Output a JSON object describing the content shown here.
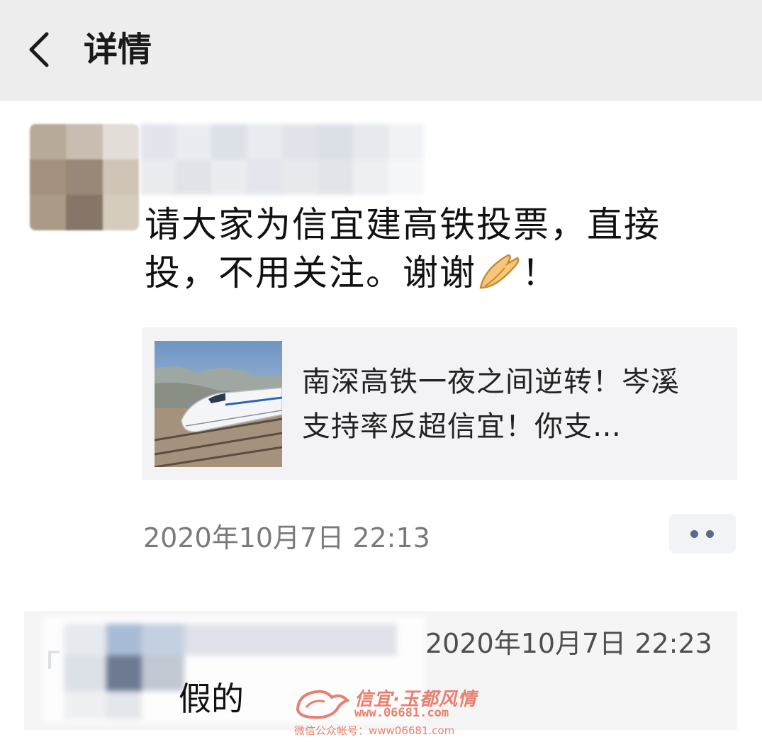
{
  "header": {
    "title": "详情"
  },
  "post": {
    "text_line1": "请大家为信宜建高铁投票，直接",
    "text_line2_a": "投，不用关注。谢谢",
    "text_line2_b": "！",
    "emoji_icon": "pray-hands-emoji",
    "timestamp": "2020年10月7日 22:13",
    "link": {
      "title": "南深高铁一夜之间逆转！岑溪支持率反超信宜！你支…",
      "thumbnail": "high-speed-train-photo"
    }
  },
  "comment": {
    "time": "2020年10月7日 22:23",
    "text": "假的"
  },
  "watermark": {
    "brand": "信宜·玉都风情",
    "url": "www.06681.com",
    "line": "微信公众帐号：www06681.com"
  },
  "colors": {
    "topbar": "#ededed",
    "link_card": "#f3f3f5",
    "more_dots": "#5a6a8c",
    "watermark": "#e8806f"
  }
}
